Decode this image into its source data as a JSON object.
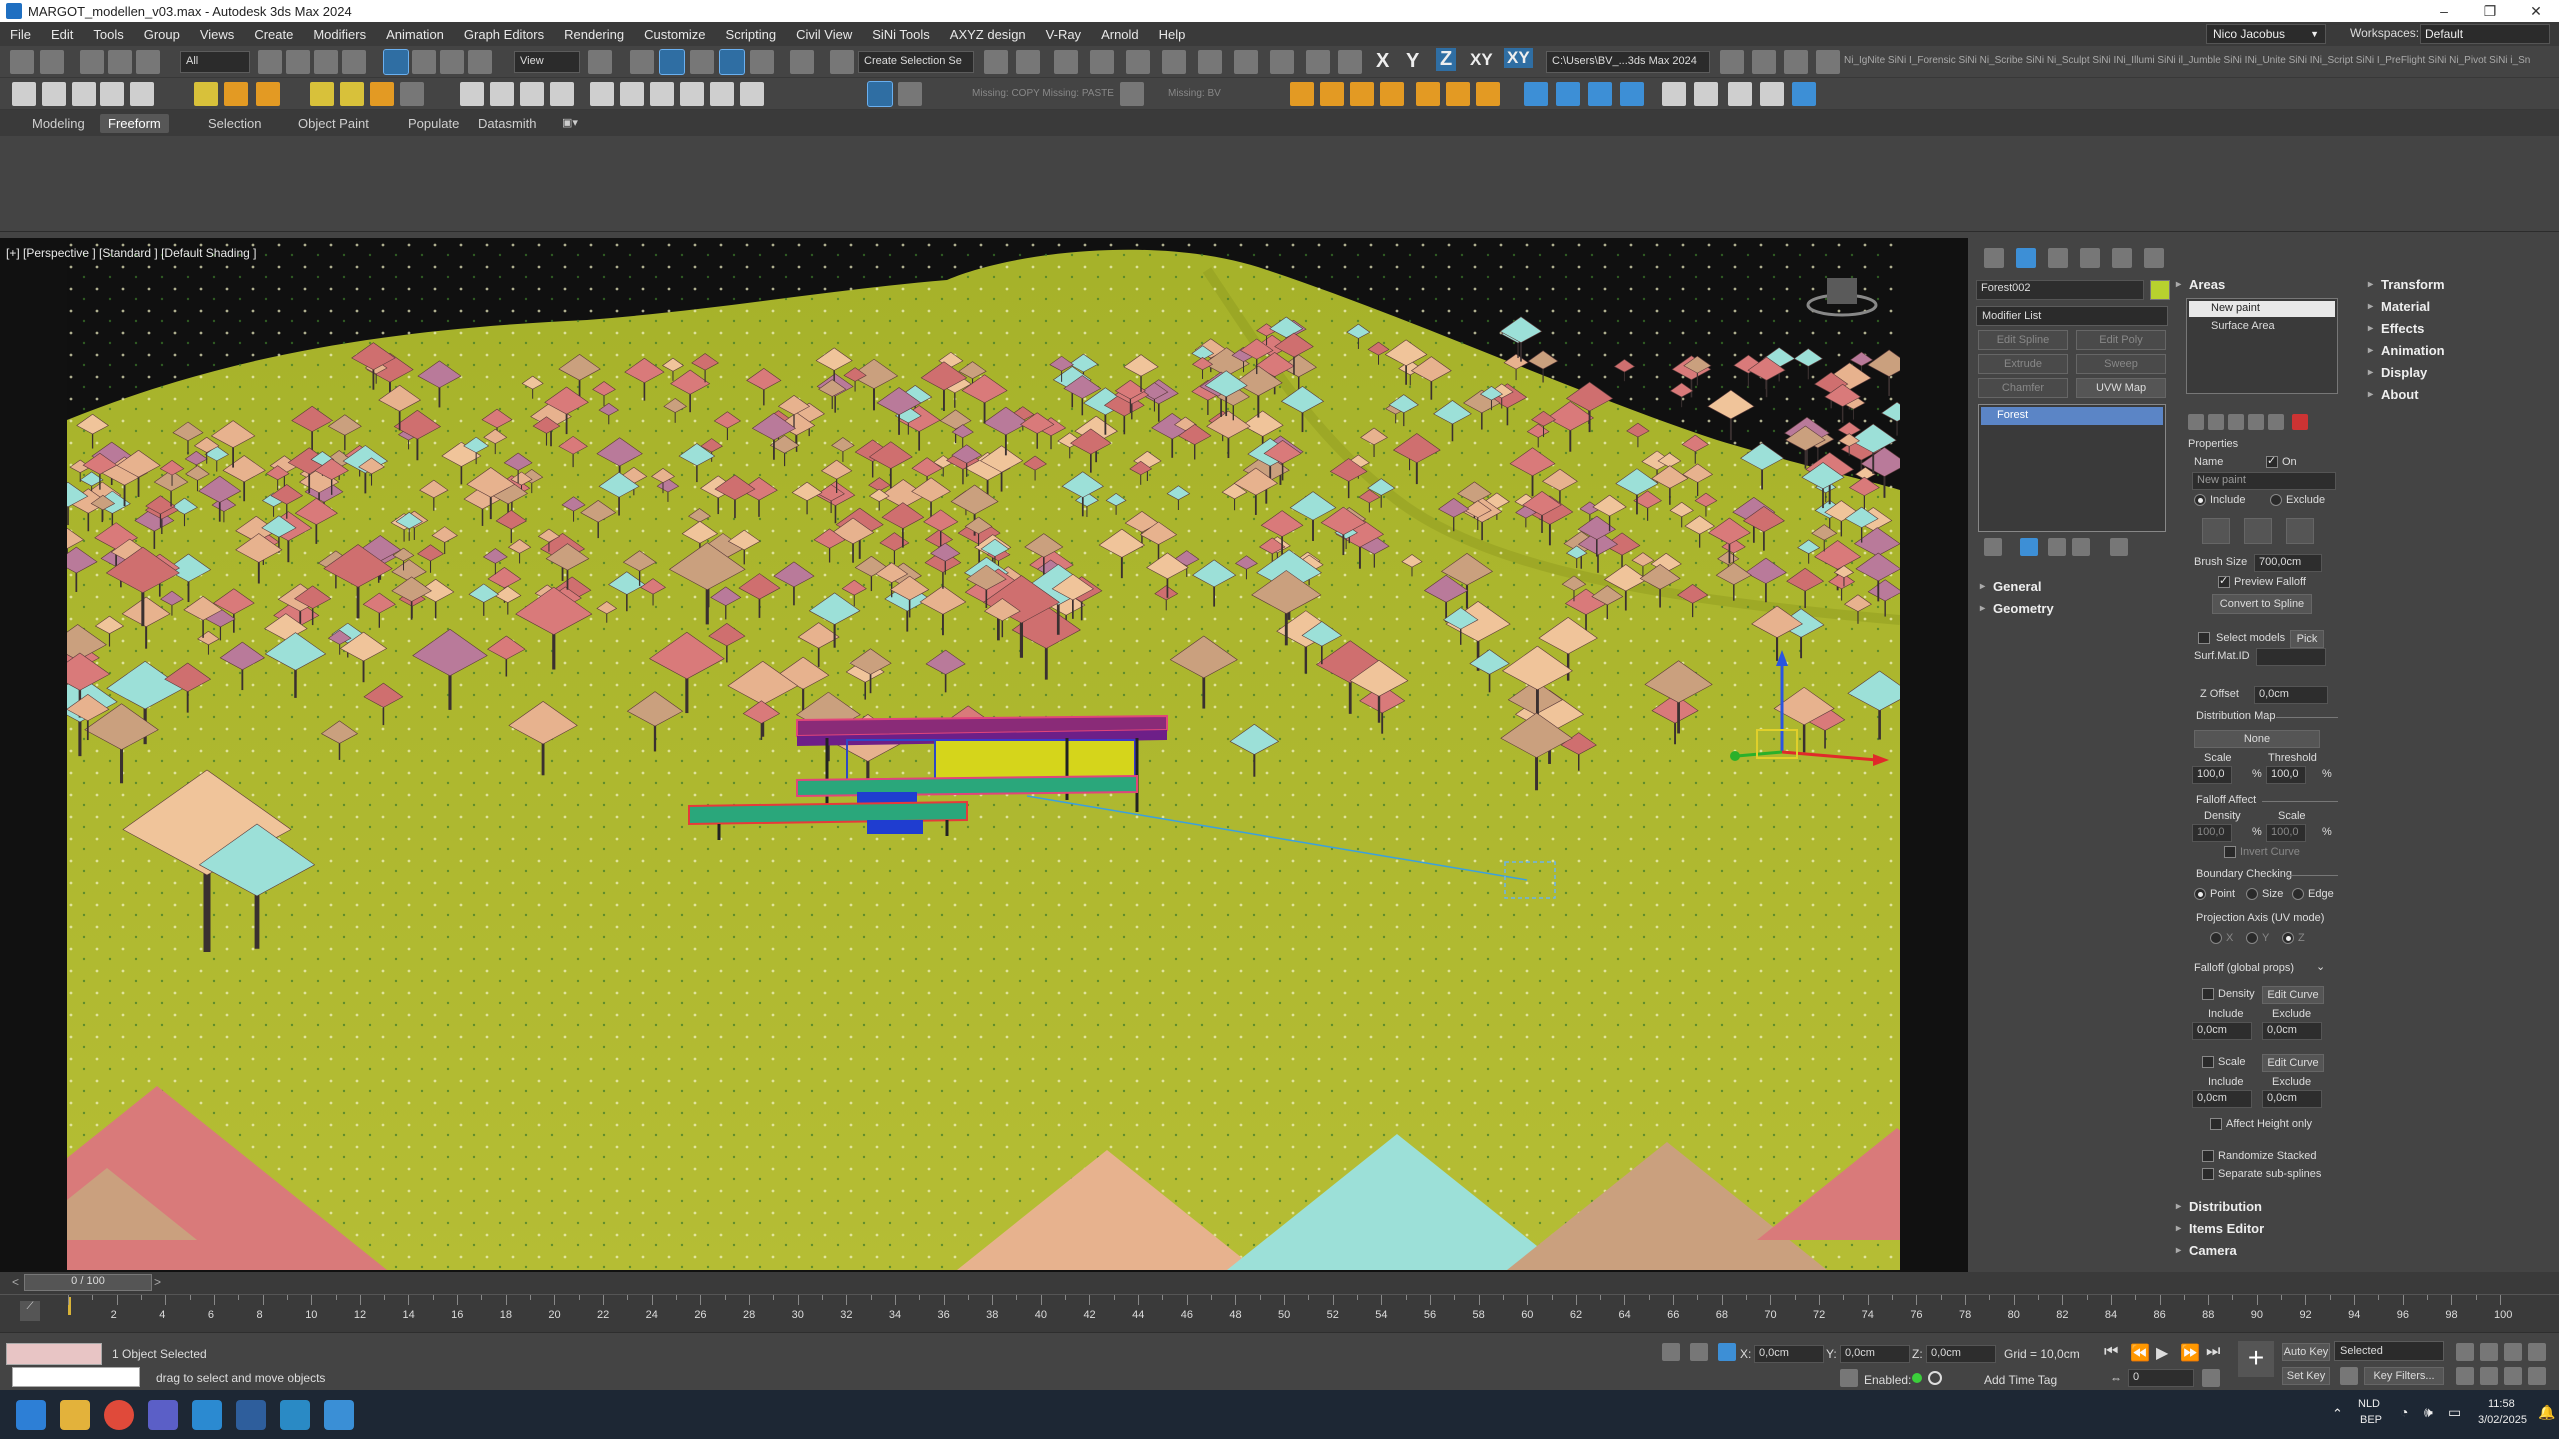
{
  "titlebar": {
    "title": "MARGOT_modellen_v03.max - Autodesk 3ds Max 2024",
    "minimize": "–",
    "maximize": "❐",
    "close": "✕"
  },
  "menubar": {
    "items": [
      "File",
      "Edit",
      "Tools",
      "Group",
      "Views",
      "Create",
      "Modifiers",
      "Animation",
      "Graph Editors",
      "Rendering",
      "Customize",
      "Scripting",
      "Civil View",
      "SiNi Tools",
      "AXYZ design",
      "V-Ray",
      "Arnold",
      "Help"
    ],
    "user": "Nico Jacobus",
    "workspaces_label": "Workspaces:",
    "workspace_value": "Default"
  },
  "toolbar": {
    "selection_filter": "All",
    "ref_coord": "View",
    "named_selection": "Create Selection Se",
    "axis_x": "X",
    "axis_y": "Y",
    "axis_z": "Z",
    "axis_xy": "XY",
    "axis_xy2": "XY",
    "project_path": "C:\\Users\\BV_...3ds Max 2024",
    "sini_strip": "Ni_IgNite  SiNi  I_Forensic  SiNi  Ni_Scribe  SiNi  Ni_Sculpt  SiNi  INi_Illumi  SiNi  il_Jumble  SiNi  INi_Unite  SiNi  INi_Script  SiNi  I_PreFlight  SiNi  Ni_Pivot  SiNi  i_Sn",
    "missing_copy": "Missing: COPY  Missing: PASTE",
    "missing_bv": "Missing: BV"
  },
  "ribbon": {
    "tabs": [
      "Modeling",
      "Freeform",
      "Selection",
      "Object Paint",
      "Populate",
      "Datasmith"
    ],
    "active_tab": "Freeform"
  },
  "viewport": {
    "label": "[+] [Perspective ] [Standard ] [Default Shading ]"
  },
  "command_panel": {
    "object_name": "Forest002",
    "object_color": "#b8d22e",
    "modifier_list": "Modifier List",
    "buttons": {
      "edit_spline": "Edit Spline",
      "edit_poly": "Edit Poly",
      "extrude": "Extrude",
      "sweep": "Sweep",
      "chamfer": "Chamfer",
      "uvw_map": "UVW Map"
    },
    "stack_item": "Forest",
    "rollouts": {
      "general": "General",
      "geometry": "Geometry"
    }
  },
  "areas_panel": {
    "title": "Areas",
    "list": [
      "New paint",
      "Surface Area"
    ],
    "properties": "Properties",
    "name_label": "Name",
    "on_label": "On",
    "name_value": "New paint",
    "include": "Include",
    "exclude": "Exclude",
    "brush_size_label": "Brush Size",
    "brush_size": "700,0cm",
    "preview_falloff": "Preview Falloff",
    "convert_to_spline": "Convert to Spline",
    "select_models": "Select models",
    "pick": "Pick",
    "surf_mat_id": "Surf.Mat.ID",
    "z_offset_label": "Z Offset",
    "z_offset": "0,0cm",
    "distribution_map": "Distribution Map",
    "none": "None",
    "scale": "Scale",
    "threshold": "Threshold",
    "scale_val": "100,0",
    "threshold_val": "100,0",
    "pct": "%",
    "falloff_affect": "Falloff Affect",
    "density": "Density",
    "density_val": "100,0",
    "scale_val2": "100,0",
    "invert_curve": "Invert Curve",
    "boundary_checking": "Boundary Checking",
    "point": "Point",
    "size": "Size",
    "edge": "Edge",
    "projection_axis": "Projection Axis (UV mode)",
    "ax_x": "X",
    "ax_y": "Y",
    "ax_z": "Z",
    "falloff_global": "Falloff (global props)",
    "edit_curve": "Edit Curve",
    "zero": "0,0cm",
    "affect_height_only": "Affect Height only",
    "randomize_stacked": "Randomize Stacked",
    "separate_sub_splines": "Separate sub-splines",
    "distribution": "Distribution",
    "items_editor": "Items Editor",
    "camera": "Camera"
  },
  "side_panel": {
    "items": [
      "Transform",
      "Material",
      "Effects",
      "Animation",
      "Display",
      "About"
    ]
  },
  "timeline": {
    "frame_counter": "0 / 100",
    "ticks": [
      "0",
      "2",
      "4",
      "6",
      "8",
      "10",
      "12",
      "14",
      "16",
      "18",
      "20",
      "22",
      "24",
      "26",
      "28",
      "30",
      "32",
      "34",
      "36",
      "38",
      "40",
      "42",
      "44",
      "46",
      "48",
      "50",
      "52",
      "54",
      "56",
      "58",
      "60",
      "62",
      "64",
      "66",
      "68",
      "70",
      "72",
      "74",
      "76",
      "78",
      "80",
      "82",
      "84",
      "86",
      "88",
      "90",
      "92",
      "94",
      "96",
      "98",
      "100"
    ]
  },
  "status": {
    "selected": "1 Object Selected",
    "prompt": "drag to select and move objects",
    "x_label": "X:",
    "x_val": "0,0cm",
    "y_label": "Y:",
    "y_val": "0,0cm",
    "z_label": "Z:",
    "z_val": "0,0cm",
    "grid": "Grid = 10,0cm",
    "enabled": "Enabled:",
    "add_time_tag": "Add Time Tag",
    "auto_key": "Auto Key",
    "set_key": "Set Key",
    "selected_dd": "Selected",
    "key_filters": "Key Filters...",
    "frame": "0"
  },
  "taskbar": {
    "lang": "NLD",
    "lang2": "BEP",
    "time": "11:58",
    "date": "3/02/2025"
  }
}
